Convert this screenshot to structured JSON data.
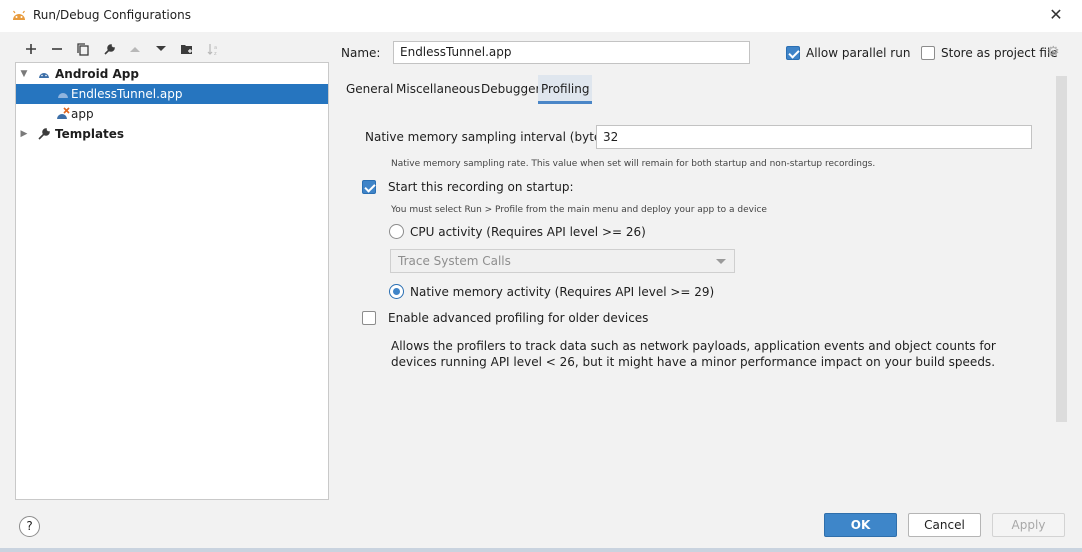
{
  "window": {
    "title": "Run/Debug Configurations"
  },
  "tree": {
    "items": [
      {
        "label": "Android App"
      },
      {
        "label": "EndlessTunnel.app"
      },
      {
        "label": "app"
      },
      {
        "label": "Templates"
      }
    ]
  },
  "form": {
    "name_label": "Name:",
    "name_value": "EndlessTunnel.app",
    "allow_parallel_label": "Allow parallel run",
    "store_project_label": "Store as project file"
  },
  "tabs": [
    {
      "label": "General"
    },
    {
      "label": "Miscellaneous"
    },
    {
      "label": "Debugger"
    },
    {
      "label": "Profiling"
    }
  ],
  "profiling": {
    "sampling_label": "Native memory sampling interval (bytes):",
    "sampling_value": "32",
    "sampling_hint": "Native memory sampling rate. This value when set will remain for both startup and non-startup recordings.",
    "start_recording_label": "Start this recording on startup:",
    "start_recording_hint": "You must select Run > Profile from the main menu and deploy your app to a device",
    "cpu_activity_label": "CPU activity (Requires API level >= 26)",
    "trace_dropdown_value": "Trace System Calls",
    "native_memory_label": "Native memory activity (Requires API level >= 29)",
    "advanced_label": "Enable advanced profiling for older devices",
    "advanced_desc": "Allows the profilers to track data such as network payloads, application events and object counts for devices running API level < 26, but it might have a minor performance impact on your build speeds."
  },
  "buttons": {
    "help": "?",
    "ok": "OK",
    "cancel": "Cancel",
    "apply": "Apply"
  },
  "colors": {
    "accent": "#3e86c9",
    "selection": "#2675bf",
    "android_green": "#7fb241"
  }
}
